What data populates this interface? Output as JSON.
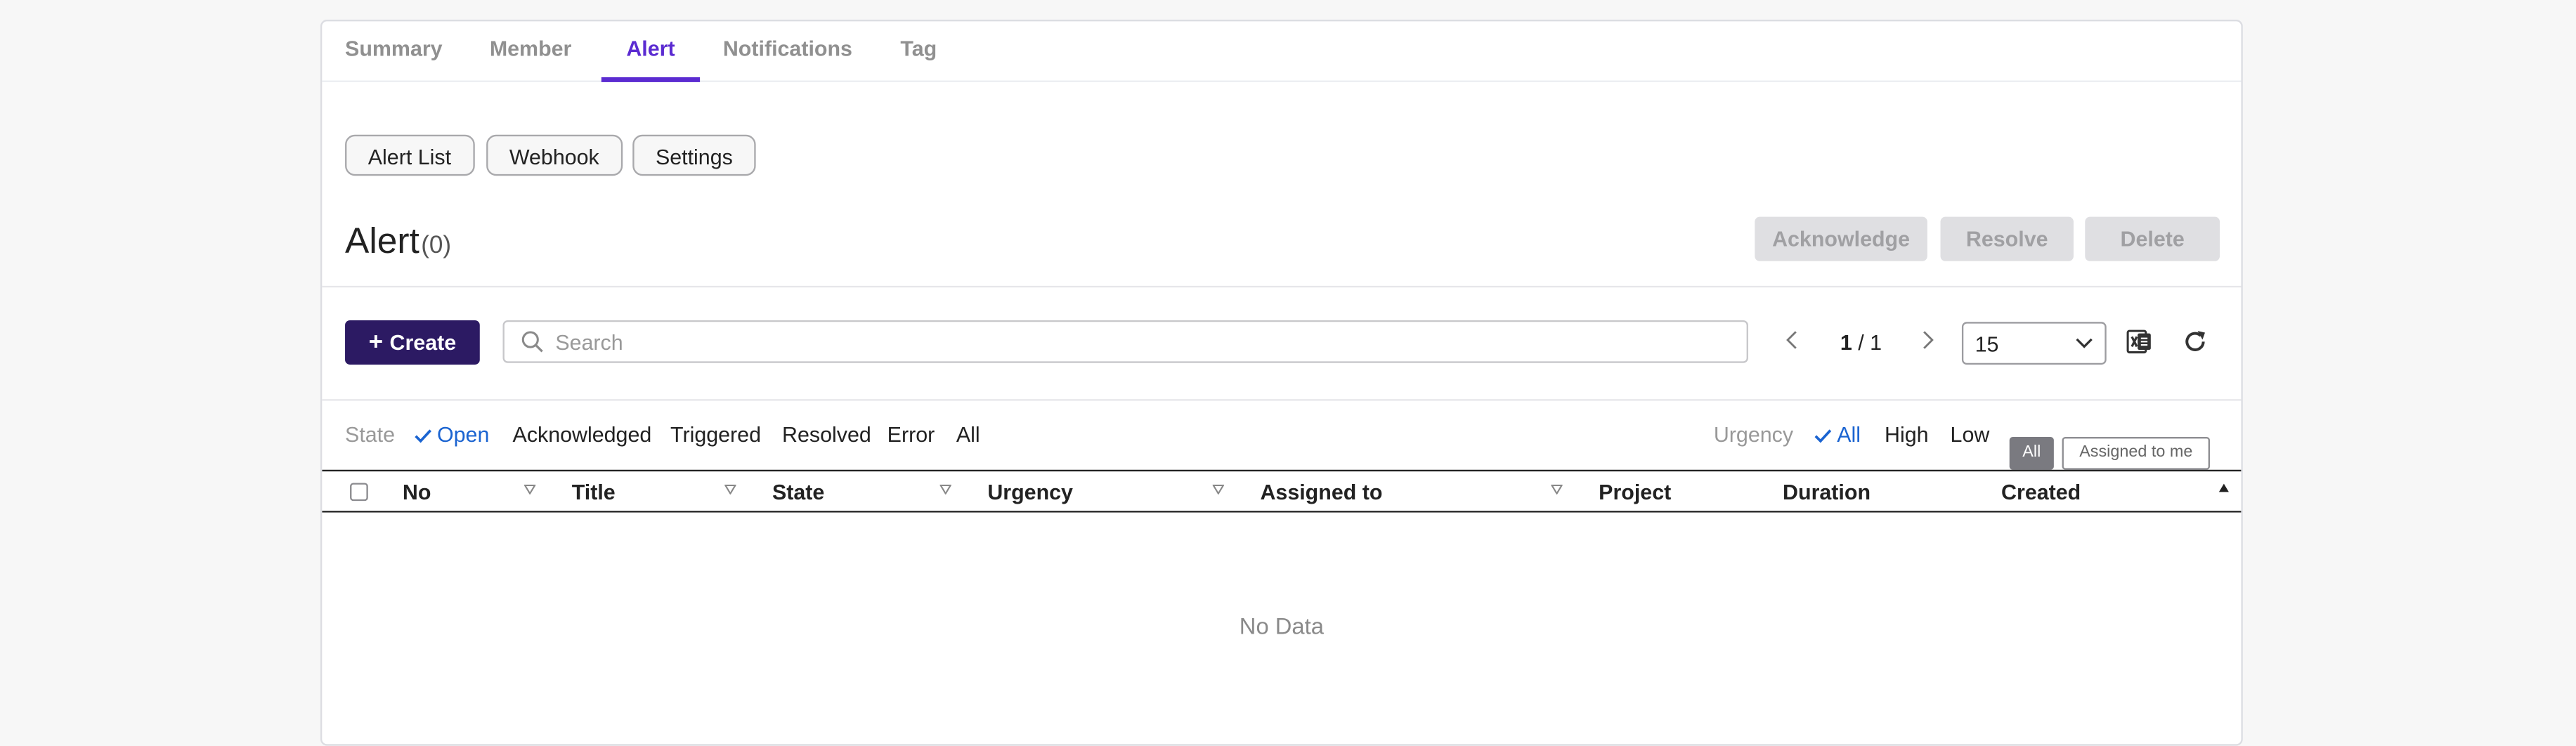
{
  "tabs": [
    {
      "label": "Summary"
    },
    {
      "label": "Member"
    },
    {
      "label": "Alert",
      "active": true
    },
    {
      "label": "Notifications"
    },
    {
      "label": "Tag"
    }
  ],
  "subnav": [
    "Alert List",
    "Webhook",
    "Settings"
  ],
  "heading": {
    "title": "Alert",
    "count": "(0)"
  },
  "actions": {
    "acknowledge": "Acknowledge",
    "resolve": "Resolve",
    "delete": "Delete"
  },
  "toolbar": {
    "create_label": "Create",
    "search_placeholder": "Search",
    "page_current": "1",
    "page_total": "/ 1",
    "page_size": "15"
  },
  "state_filter": {
    "label": "State",
    "options": [
      "Open",
      "Acknowledged",
      "Triggered",
      "Resolved",
      "Error",
      "All"
    ],
    "selected": "Open"
  },
  "urgency_filter": {
    "label": "Urgency",
    "options": [
      "All",
      "High",
      "Low"
    ],
    "selected": "All"
  },
  "assignee_toggle": {
    "all": "All",
    "assigned_to_me": "Assigned to me",
    "selected": "All"
  },
  "table": {
    "columns": [
      "No",
      "Title",
      "State",
      "Urgency",
      "Assigned to",
      "Project",
      "Duration",
      "Created"
    ],
    "sort": {
      "column": "Created",
      "direction": "ascending"
    },
    "rows": [],
    "empty_text": "No Data"
  },
  "colors": {
    "accent": "#5b2bd1",
    "primary_button": "#2c1a63",
    "link": "#1b64d1",
    "disabled": "#dfdfe2"
  },
  "icons": [
    "search-icon",
    "chevron-left-icon",
    "chevron-right-icon",
    "chevron-down-icon",
    "excel-icon",
    "refresh-icon",
    "check-icon",
    "sort-down-icon",
    "sort-up-icon"
  ]
}
